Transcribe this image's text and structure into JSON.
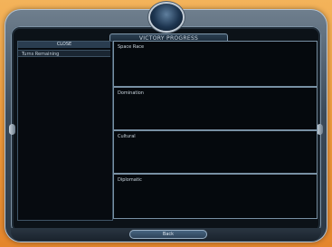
{
  "screen": {
    "title": "VICTORY PROGRESS"
  },
  "left_panel": {
    "header": "CLOSE",
    "rows": [
      "Turns Remaining"
    ]
  },
  "sections": [
    {
      "label": "Space Race"
    },
    {
      "label": "Domination"
    },
    {
      "label": "Cultural"
    },
    {
      "label": "Diplomatic"
    }
  ],
  "footer": {
    "back_label": "Back"
  },
  "colors": {
    "frame_orange": "#ef9a3b",
    "panel_bg": "#0c1218",
    "accent_blue": "#2a3f55"
  }
}
